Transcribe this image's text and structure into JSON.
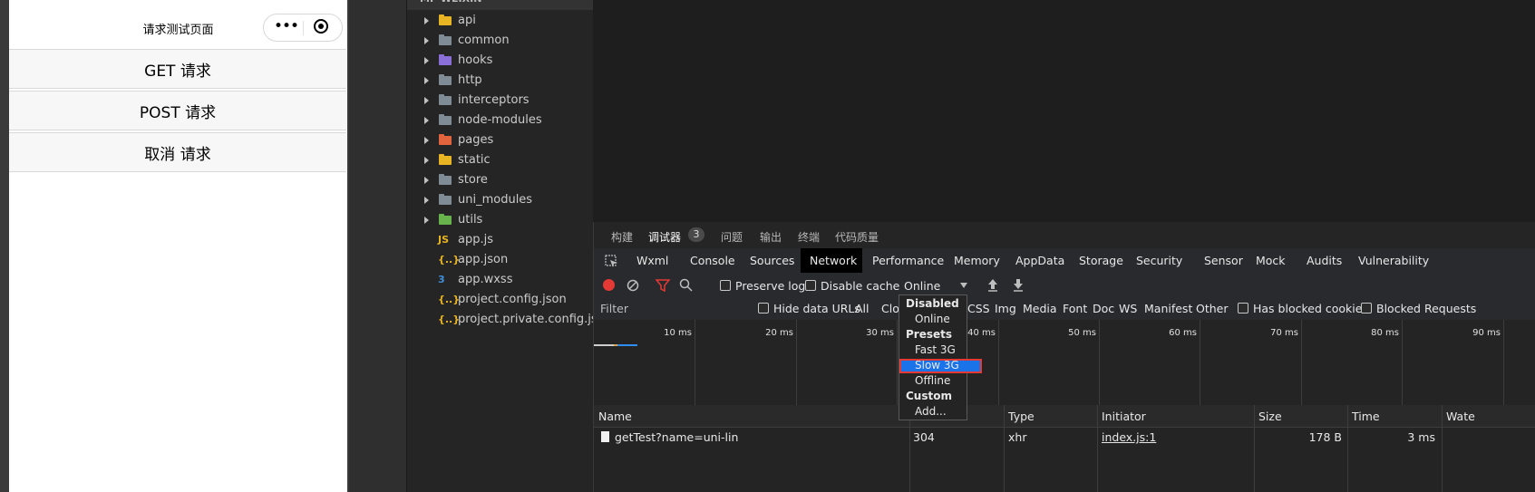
{
  "simulator": {
    "page_title": "请求测试页面",
    "buttons": [
      "GET 请求",
      "POST 请求",
      "取消 请求"
    ]
  },
  "explorer": {
    "project_name": "MP-WEIXIN",
    "folders": [
      {
        "label": "api",
        "color": "#e8b424"
      },
      {
        "label": "common",
        "color": "#7f8b95"
      },
      {
        "label": "hooks",
        "color": "#8b6fd8"
      },
      {
        "label": "http",
        "color": "#7f8b95"
      },
      {
        "label": "interceptors",
        "color": "#7f8b95"
      },
      {
        "label": "node-modules",
        "color": "#7f8b95"
      },
      {
        "label": "pages",
        "color": "#e2643c"
      },
      {
        "label": "static",
        "color": "#e8b424"
      },
      {
        "label": "store",
        "color": "#7f8b95"
      },
      {
        "label": "uni_modules",
        "color": "#7f8b95"
      },
      {
        "label": "utils",
        "color": "#69b34c"
      }
    ],
    "files": [
      {
        "label": "app.js",
        "icon": "JS",
        "color": "#e8b424"
      },
      {
        "label": "app.json",
        "icon": "{..}",
        "color": "#e8b424"
      },
      {
        "label": "app.wxss",
        "icon": "3",
        "color": "#3f8ed8"
      },
      {
        "label": "project.config.json",
        "icon": "{..}",
        "color": "#e8b424"
      },
      {
        "label": "project.private.config.json",
        "icon": "{..}",
        "color": "#e8b424"
      }
    ]
  },
  "devtools": {
    "top_tabs": [
      "构建",
      "调试器",
      "问题",
      "输出",
      "终端",
      "代码质量"
    ],
    "debugger_badge": "3",
    "panel_tabs": [
      "Wxml",
      "Console",
      "Sources",
      "Network",
      "Performance",
      "Memory",
      "AppData",
      "Storage",
      "Security",
      "Sensor",
      "Mock",
      "Audits",
      "Vulnerability"
    ],
    "active_panel": "Network",
    "toolbar": {
      "preserve_log": "Preserve log",
      "disable_cache": "Disable cache",
      "throttle_value": "Online"
    },
    "filterbar": {
      "filter_placeholder": "Filter",
      "hide_data_urls": "Hide data URLs",
      "types": [
        "All",
        "Clou",
        "CSS",
        "Img",
        "Media",
        "Font",
        "Doc",
        "WS",
        "Manifest",
        "Other"
      ],
      "has_blocked_cookies": "Has blocked cookies",
      "blocked_requests": "Blocked Requests"
    },
    "timeline_ticks": [
      "10 ms",
      "20 ms",
      "30 ms",
      "40 ms",
      "50 ms",
      "60 ms",
      "70 ms",
      "80 ms",
      "90 ms"
    ],
    "table": {
      "headers": [
        "Name",
        "Type",
        "Initiator",
        "Size",
        "Time",
        "Wate"
      ],
      "rows": [
        {
          "name": "getTest?name=uni-lin",
          "status": "304",
          "type": "xhr",
          "initiator": "index.js:1",
          "size": "178 B",
          "time": "3 ms"
        }
      ]
    },
    "throttle_menu": {
      "items": [
        {
          "label": "Disabled",
          "kind": "header"
        },
        {
          "label": "Online",
          "kind": "option"
        },
        {
          "label": "Presets",
          "kind": "header"
        },
        {
          "label": "Fast 3G",
          "kind": "option"
        },
        {
          "label": "Slow 3G",
          "kind": "selected"
        },
        {
          "label": "Offline",
          "kind": "option"
        },
        {
          "label": "Custom",
          "kind": "header"
        },
        {
          "label": "Add...",
          "kind": "option"
        }
      ]
    }
  }
}
